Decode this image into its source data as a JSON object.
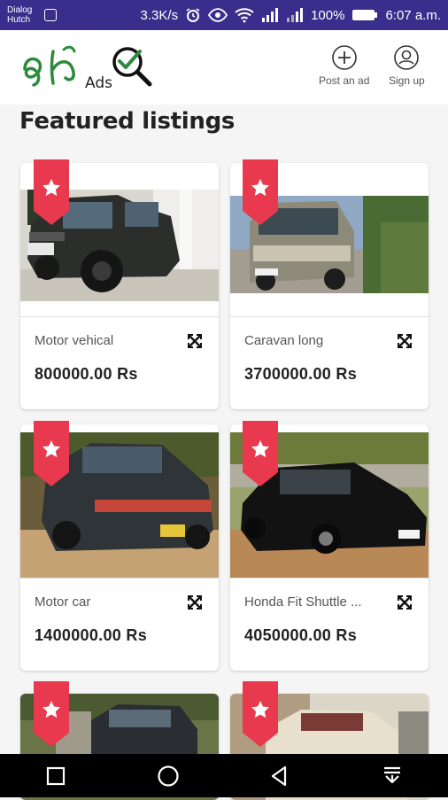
{
  "status_bar": {
    "carrier_line1": "Dialog",
    "carrier_line2": "Hutch",
    "speed": "3.3K/s",
    "battery": "100%",
    "time": "6:07 a.m."
  },
  "header": {
    "logo_text": "Ads",
    "post_label": "Post an ad",
    "signup_label": "Sign up"
  },
  "page": {
    "title": "Featured listings"
  },
  "listings": [
    {
      "name": "Motor vehical",
      "price": "800000.00 Rs"
    },
    {
      "name": "Caravan long",
      "price": "3700000.00 Rs"
    },
    {
      "name": "Motor car",
      "price": "1400000.00 Rs"
    },
    {
      "name": "Honda Fit Shuttle ...",
      "price": "4050000.00 Rs"
    }
  ],
  "colors": {
    "status_bar": "#3a2e8c",
    "ribbon": "#e8394e",
    "logo_green": "#2e8b3e"
  },
  "icons": {
    "post": "plus-circle-icon",
    "signup": "account-circle-icon",
    "expand": "arrows-expand-icon",
    "ribbon": "star-bookmark-icon"
  }
}
